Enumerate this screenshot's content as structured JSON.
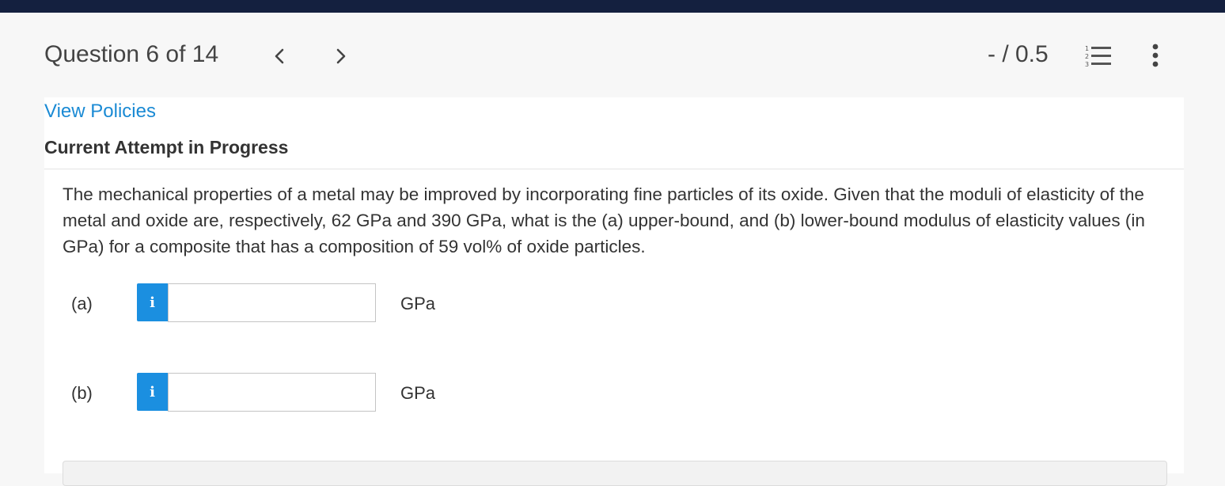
{
  "header": {
    "question_title": "Question 6 of 14",
    "score": "- / 0.5",
    "icons": {
      "prev": "chevron-left-icon",
      "next": "chevron-right-icon",
      "list": "numbered-list-icon",
      "more": "more-vertical-icon"
    }
  },
  "links": {
    "view_policies": "View Policies"
  },
  "status": {
    "attempt": "Current Attempt in Progress"
  },
  "question": {
    "text": "The mechanical properties of a metal may be improved by incorporating fine particles of its oxide. Given that the moduli of elasticity of the metal and oxide are, respectively, 62 GPa and 390 GPa, what is the (a) upper-bound, and (b) lower-bound modulus of elasticity values (in GPa) for a composite that has a composition of 59 vol% of oxide particles."
  },
  "parts": [
    {
      "label": "(a)",
      "info": "i",
      "value": "",
      "unit": "GPa"
    },
    {
      "label": "(b)",
      "info": "i",
      "value": "",
      "unit": "GPa"
    }
  ],
  "colors": {
    "topbar": "#14203f",
    "link": "#1a8ad4",
    "info_button": "#1b8fe0"
  }
}
